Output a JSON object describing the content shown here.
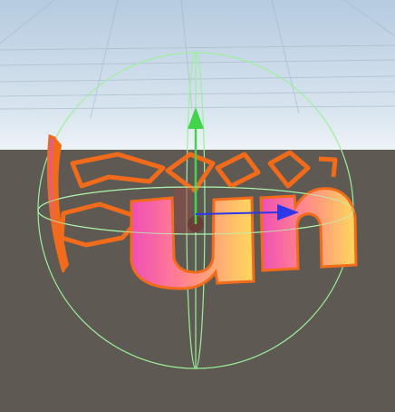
{
  "scene": {
    "sky_top_color": "#bcd0e3",
    "horizon_color": "#e7eef4",
    "ground_color": "#5e5953",
    "gizmo_sphere_color": "#9df09a",
    "outline_color": "#f26b1b",
    "text_gradient_start": "#ee4fb5",
    "text_gradient_end": "#ffd95c"
  },
  "gizmos": {
    "y_axis": {
      "color": "#42d44b",
      "icon": "up-arrow-icon"
    },
    "x_axis": {
      "color": "#2f37e6",
      "icon": "right-arrow-icon"
    },
    "pivot": {
      "color": "#6b3d37",
      "icon": "pivot-point-icon"
    }
  },
  "text_object": {
    "text": "un"
  }
}
